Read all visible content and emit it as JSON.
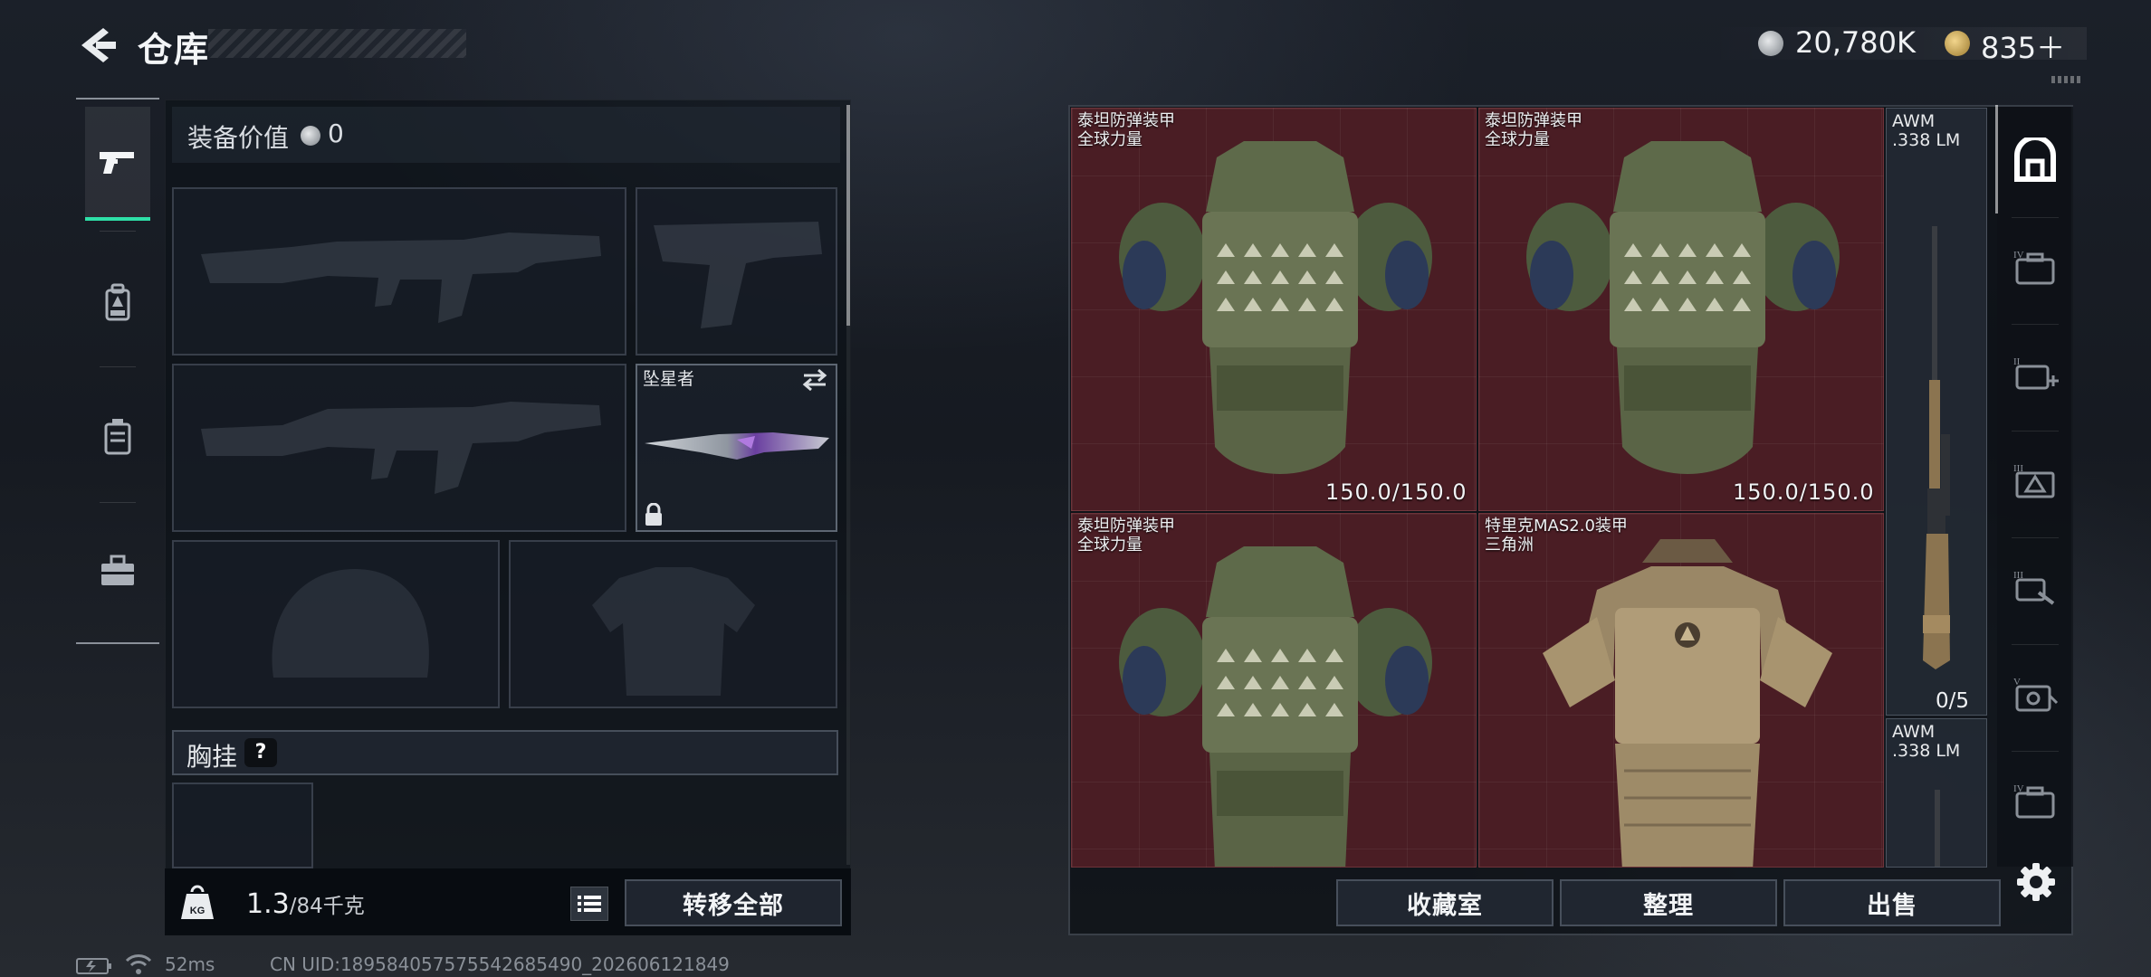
{
  "header": {
    "title": "仓库"
  },
  "currency": {
    "silver": "20,780K",
    "gold": "835＋"
  },
  "equipment": {
    "value_label": "装备价值",
    "value": "0",
    "melee_name": "坠星者",
    "chest_label": "胸挂",
    "chest_help": "?"
  },
  "capacity": {
    "current": "1.3",
    "max": "/84千克",
    "transfer_all": "转移全部"
  },
  "storage": {
    "items": [
      {
        "name": "泰坦防弹装甲",
        "sub": "全球力量",
        "durability": "150.0/150.0"
      },
      {
        "name": "泰坦防弹装甲",
        "sub": "全球力量",
        "durability": "150.0/150.0"
      },
      {
        "name": "泰坦防弹装甲",
        "sub": "全球力量",
        "durability": ""
      },
      {
        "name": "特里克MAS2.0装甲",
        "sub": "三角洲",
        "durability": ""
      }
    ],
    "rifles": [
      {
        "name": "AWM",
        "ammo": ".338 LM",
        "count": "0/5"
      },
      {
        "name": "AWM",
        "ammo": ".338 LM"
      }
    ],
    "buttons": {
      "collection": "收藏室",
      "organize": "整理",
      "sell": "出售"
    },
    "category_icons": [
      "backpack-capacity-icon",
      "case-iv-icon",
      "medkit-ii-icon",
      "armor-iii-icon",
      "tool-iii-icon",
      "safe-v-icon",
      "case-iv-icon"
    ]
  },
  "status": {
    "ping": "52ms",
    "uid": "CN UID:18958405757554268549​0_202606121849"
  },
  "colors": {
    "accent": "#2ee0a8",
    "cell_red": "#4a1d24",
    "panel": "#0a0e14"
  }
}
